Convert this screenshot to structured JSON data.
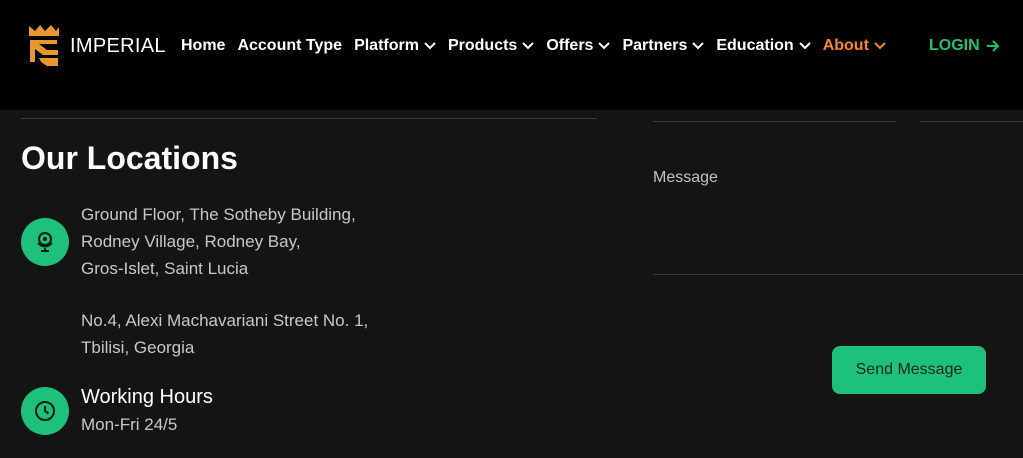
{
  "brand": {
    "name": "IMPERIAL",
    "logo_color": "#e8962e"
  },
  "nav": [
    {
      "label": "Home",
      "dropdown": false
    },
    {
      "label": "Account Type",
      "dropdown": false
    },
    {
      "label": "Platform",
      "dropdown": true
    },
    {
      "label": "Products",
      "dropdown": true
    },
    {
      "label": "Offers",
      "dropdown": true
    },
    {
      "label": "Partners",
      "dropdown": true
    },
    {
      "label": "Education",
      "dropdown": true
    },
    {
      "label": "About",
      "dropdown": true,
      "active": true
    }
  ],
  "login": {
    "label": "LOGIN",
    "color": "#22c06b"
  },
  "locations": {
    "title": "Our Locations",
    "address_1": [
      "Ground Floor, The Sotheby Building,",
      "Rodney Village, Rodney Bay,",
      "Gros-Islet, Saint Lucia"
    ],
    "address_2": [
      "No.4, Alexi Machavariani Street No. 1,",
      "Tbilisi, Georgia"
    ],
    "location_icon": "globe-pin-icon"
  },
  "working_hours": {
    "title": "Working Hours",
    "value": "Mon-Fri 24/5",
    "icon": "clock-icon"
  },
  "form": {
    "message_label": "Message",
    "send_label": "Send Message"
  },
  "colors": {
    "accent_green": "#1fc07a",
    "active_nav": "#f5862c",
    "background": "#141414",
    "header": "#000000"
  }
}
